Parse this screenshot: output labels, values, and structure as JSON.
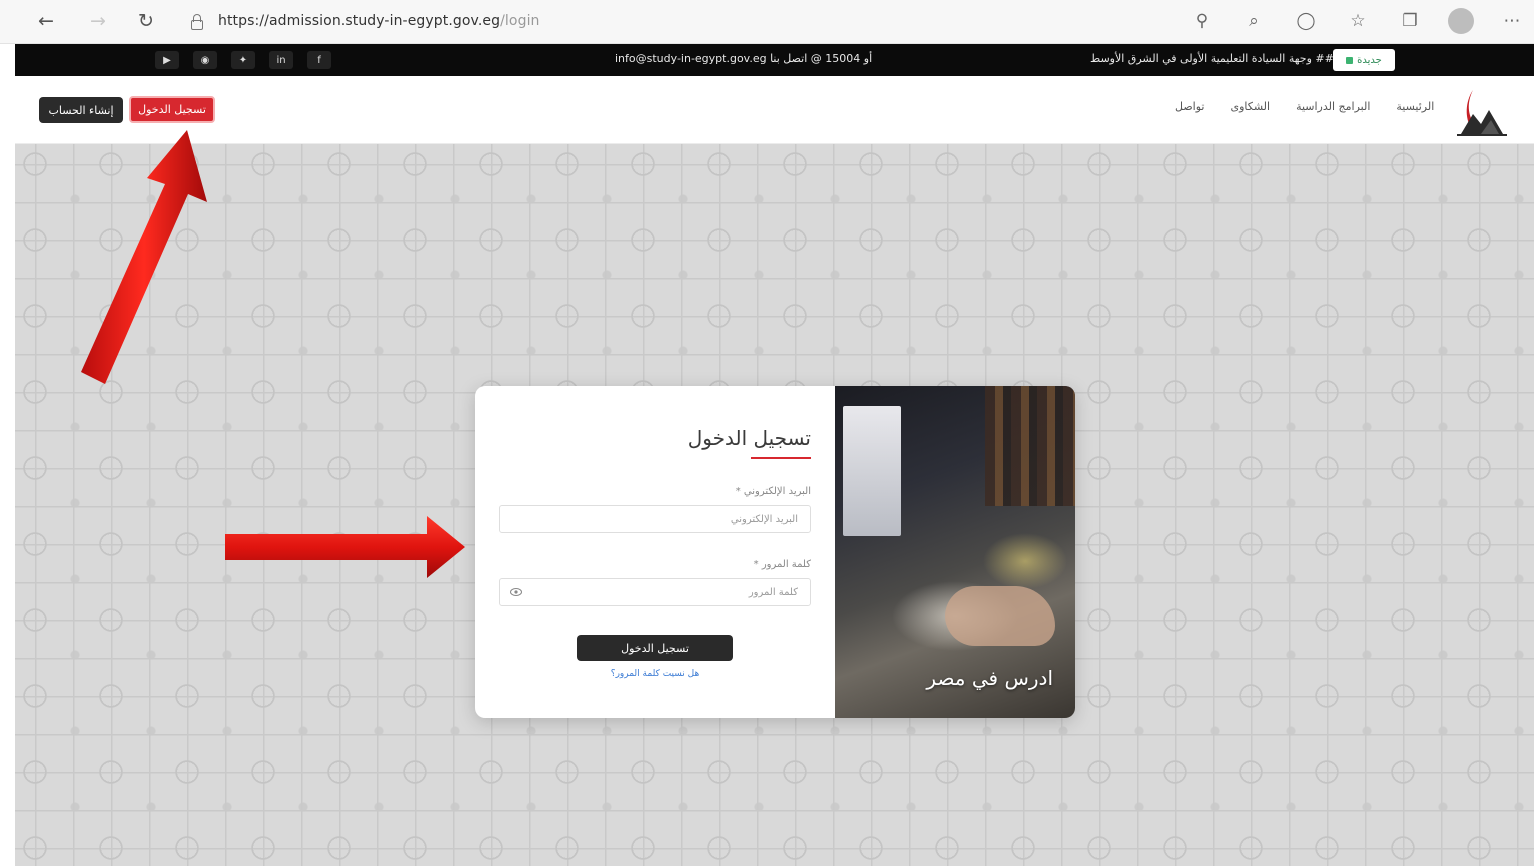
{
  "browser": {
    "url_main": "https://admission.study-in-egypt.gov.eg",
    "url_path": "/login"
  },
  "topbar": {
    "contact_text": "info@study-in-egypt.gov.eg أو 15004 @ اتصل بنا",
    "news_text": "## وجهة السيادة التعليمية الأولى في الشرق الأوسط",
    "news_badge": "جديدة"
  },
  "header": {
    "register_button": "إنشاء الحساب",
    "login_button": "تسجيل الدخول",
    "nav": [
      "الرئيسية",
      "البرامج الدراسية",
      "الشكاوى",
      "تواصل"
    ]
  },
  "login_form": {
    "title": "تسجيل الدخول",
    "email_label": "البريد الإلكتروني *",
    "email_placeholder": "البريد الإلكتروني",
    "password_label": "كلمة المرور *",
    "password_placeholder": "كلمة المرور",
    "submit": "تسجيل الدخول",
    "forgot": "هل نسيت كلمة المرور؟"
  },
  "photo": {
    "caption": "ادرس في مصر"
  },
  "colors": {
    "brand_red": "#d7282f",
    "dark": "#2a2a2a",
    "topbar": "#0b0b0b",
    "link_blue": "#3b7bd4"
  }
}
